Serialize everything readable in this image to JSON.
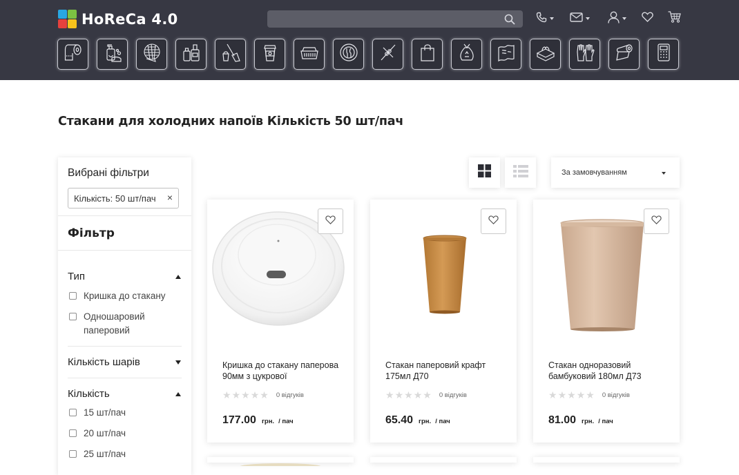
{
  "header": {
    "logo_text": "HoReCa 4.0",
    "search_placeholder": "",
    "icons": [
      "phone-icon",
      "mail-icon",
      "user-icon",
      "heart-icon",
      "cart-icon"
    ]
  },
  "categories": [
    {
      "name": "toilet-paper-icon"
    },
    {
      "name": "soap-dispenser-icon"
    },
    {
      "name": "sponge-icon"
    },
    {
      "name": "detergent-bottles-icon"
    },
    {
      "name": "broom-bucket-icon"
    },
    {
      "name": "coffee-cup-icon"
    },
    {
      "name": "food-container-icon"
    },
    {
      "name": "plate-cutlery-icon"
    },
    {
      "name": "skewers-icon"
    },
    {
      "name": "paper-bag-icon"
    },
    {
      "name": "garbage-bag-icon"
    },
    {
      "name": "cleaning-cloth-icon"
    },
    {
      "name": "napkins-icon"
    },
    {
      "name": "gloves-icon"
    },
    {
      "name": "foil-roll-icon"
    },
    {
      "name": "cash-register-icon"
    }
  ],
  "page": {
    "title": "Стакани для холодних напоїв Кількість 50 шт/пач"
  },
  "sidebar": {
    "selected_title": "Вибрані фільтри",
    "selected_chip": "Кількість: 50 шт/пач",
    "chip_remove": "×",
    "filter_title": "Фільтр",
    "groups": [
      {
        "title": "Тип",
        "options": [
          "Кришка до стакану",
          "Одношаровий",
          "паперовий"
        ]
      },
      {
        "title": "Кількість шарів"
      },
      {
        "title": "Кількість",
        "options": [
          "15 шт/пач",
          "20 шт/пач",
          "25 шт/пач"
        ]
      }
    ]
  },
  "toolbar": {
    "sort_label": "За замовчуванням"
  },
  "products": [
    {
      "name": "Кришка до стакану паперова 90мм з цукрової",
      "reviews": "0 відгуків",
      "price": "177.00",
      "currency": "грн.",
      "unit": "/ пач",
      "rating": 0
    },
    {
      "name": "Стакан паперовий крафт 175мл Д70",
      "reviews": "0 відгуків",
      "price": "65.40",
      "currency": "грн.",
      "unit": "/ пач",
      "rating": 0
    },
    {
      "name": "Стакан одноразовий бамбуковий 180мл Д73",
      "reviews": "0 відгуків",
      "price": "81.00",
      "currency": "грн.",
      "unit": "/ пач",
      "rating": 0
    }
  ],
  "colors": {
    "header_bg": "#373843",
    "search_bg": "#5c5d67",
    "logo_tiles": [
      "#29a7e1",
      "#7cc242",
      "#e6413d",
      "#f6c21c"
    ]
  }
}
